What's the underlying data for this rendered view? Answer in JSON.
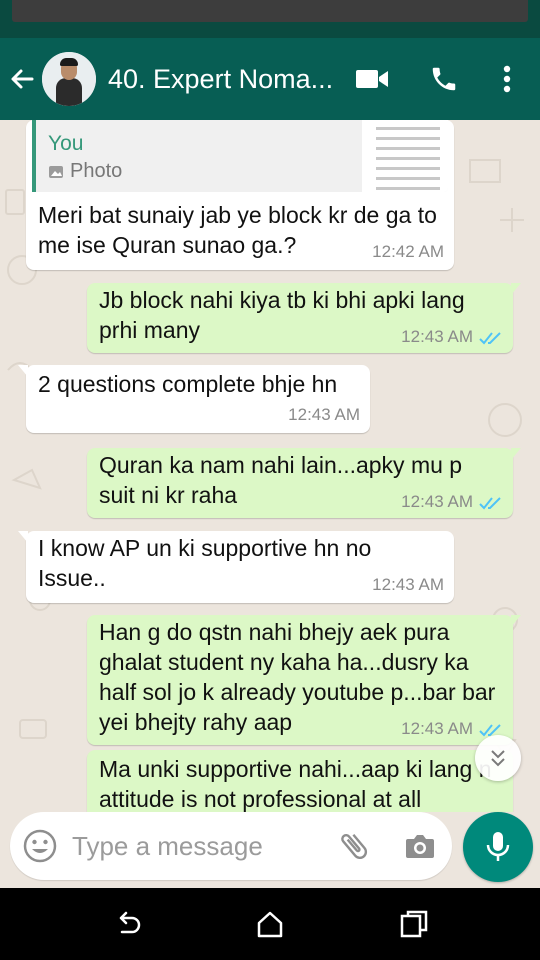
{
  "header": {
    "contact_name": "40. Expert Noma...",
    "icons": [
      "back-arrow-icon",
      "video-call-icon",
      "phone-icon",
      "more-options-icon"
    ]
  },
  "messages": [
    {
      "direction": "incoming",
      "quote": {
        "author": "You",
        "type": "Photo"
      },
      "text": "Meri bat sunaiy jab ye block kr de ga to me ise Quran sunao ga.?",
      "time": "12:42 AM"
    },
    {
      "direction": "outgoing",
      "text": "Jb block nahi kiya tb ki bhi apki lang prhi many",
      "time": "12:43 AM",
      "status": "read"
    },
    {
      "direction": "incoming",
      "text": "2 questions complete bhje hn",
      "time": "12:43 AM"
    },
    {
      "direction": "outgoing",
      "text": "Quran ka nam nahi lain...apky mu p suit ni kr raha",
      "time": "12:43 AM",
      "status": "read"
    },
    {
      "direction": "incoming",
      "text": "I know AP un ki supportive hn no Issue..",
      "time": "12:43 AM"
    },
    {
      "direction": "outgoing",
      "text": "Han g do qstn nahi bhejy aek pura ghalat student ny kaha ha...dusry ka half sol jo k already youtube p...bar bar yei bhejty rahy aap",
      "time": "12:43 AM",
      "status": "read"
    },
    {
      "direction": "outgoing",
      "text": "Ma unki supportive nahi...aap ki lang n attitude is not professional at all"
    }
  ],
  "composer": {
    "placeholder": "Type a message",
    "icons": [
      "emoji-icon",
      "attach-icon",
      "camera-icon",
      "mic-icon"
    ]
  },
  "navbar": {
    "icons": [
      "nav-back-icon",
      "nav-home-icon",
      "nav-recents-icon"
    ]
  },
  "colors": {
    "header": "#075e54",
    "chat_bg": "#ece5dd",
    "outgoing_bubble": "#dcf8c6",
    "incoming_bubble": "#ffffff",
    "accent": "#00897b",
    "read_ticks": "#4fc3f7",
    "quote_bar": "#35987a"
  }
}
